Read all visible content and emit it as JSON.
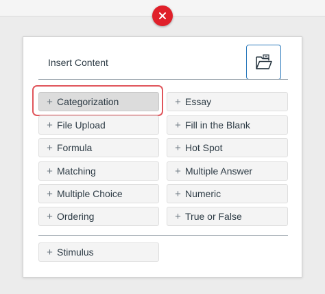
{
  "panel": {
    "title": "Insert Content",
    "close_icon": "close-icon",
    "folder_icon": "folder-open-icon"
  },
  "items": [
    {
      "label": "Categorization",
      "selected": true
    },
    {
      "label": "Essay"
    },
    {
      "label": "File Upload"
    },
    {
      "label": "Fill in the Blank"
    },
    {
      "label": "Formula"
    },
    {
      "label": "Hot Spot"
    },
    {
      "label": "Matching"
    },
    {
      "label": "Multiple Answer"
    },
    {
      "label": "Multiple Choice"
    },
    {
      "label": "Numeric"
    },
    {
      "label": "Ordering"
    },
    {
      "label": "True or False"
    }
  ],
  "stimulus": {
    "label": "Stimulus"
  },
  "colors": {
    "close_button": "#e0202a",
    "folder_border": "#2b7abc",
    "highlight": "#e0555b"
  }
}
